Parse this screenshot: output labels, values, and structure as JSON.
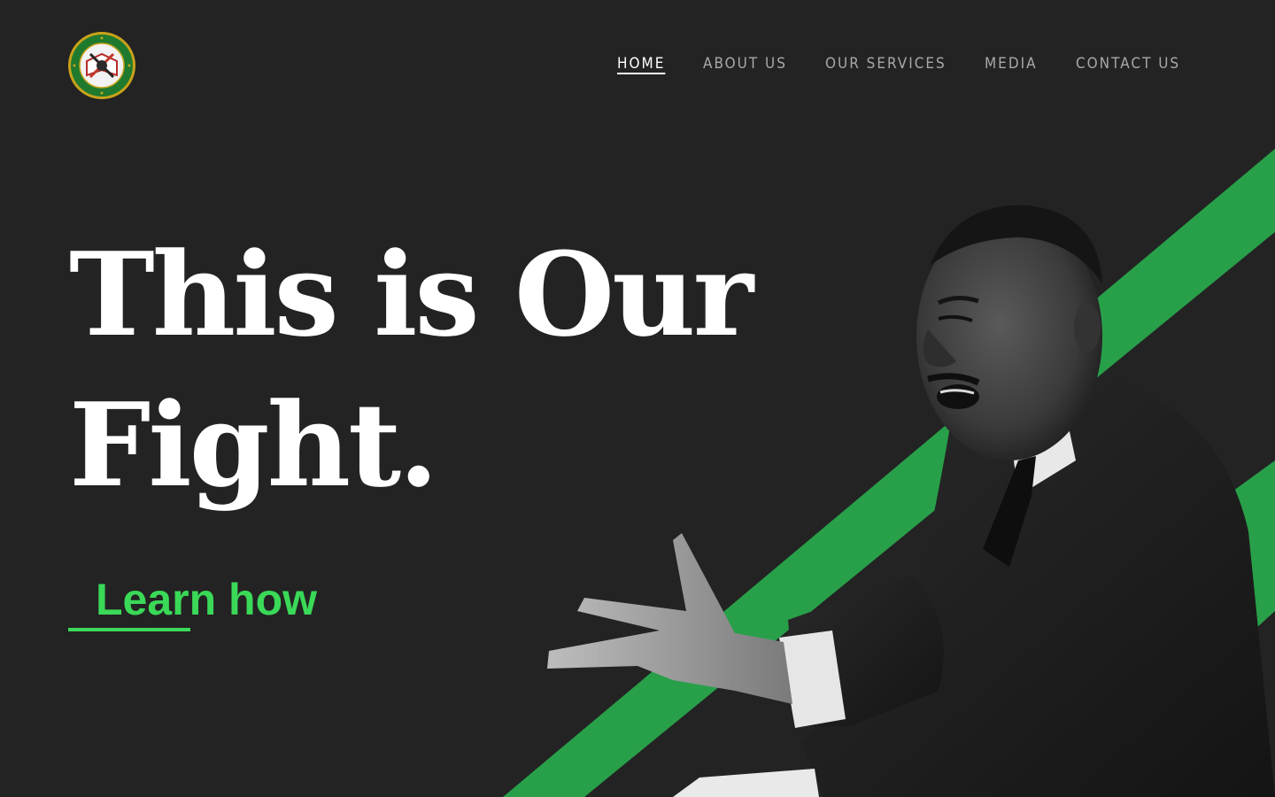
{
  "nav": {
    "items": [
      {
        "label": "HOME",
        "active": true
      },
      {
        "label": "ABOUT US",
        "active": false
      },
      {
        "label": "OUR SERVICES",
        "active": false
      },
      {
        "label": "MEDIA",
        "active": false
      },
      {
        "label": "CONTACT US",
        "active": false
      }
    ]
  },
  "hero": {
    "headline_line1": "This is Our",
    "headline_line2": "Fight.",
    "cta_label": "Learn how"
  },
  "colors": {
    "background": "#232323",
    "accent_green": "#28a04a",
    "cta_green": "#3ad957",
    "nav_text": "#a8a8a8",
    "nav_active": "#ffffff"
  },
  "icons": {
    "logo": "organization-seal-logo"
  }
}
